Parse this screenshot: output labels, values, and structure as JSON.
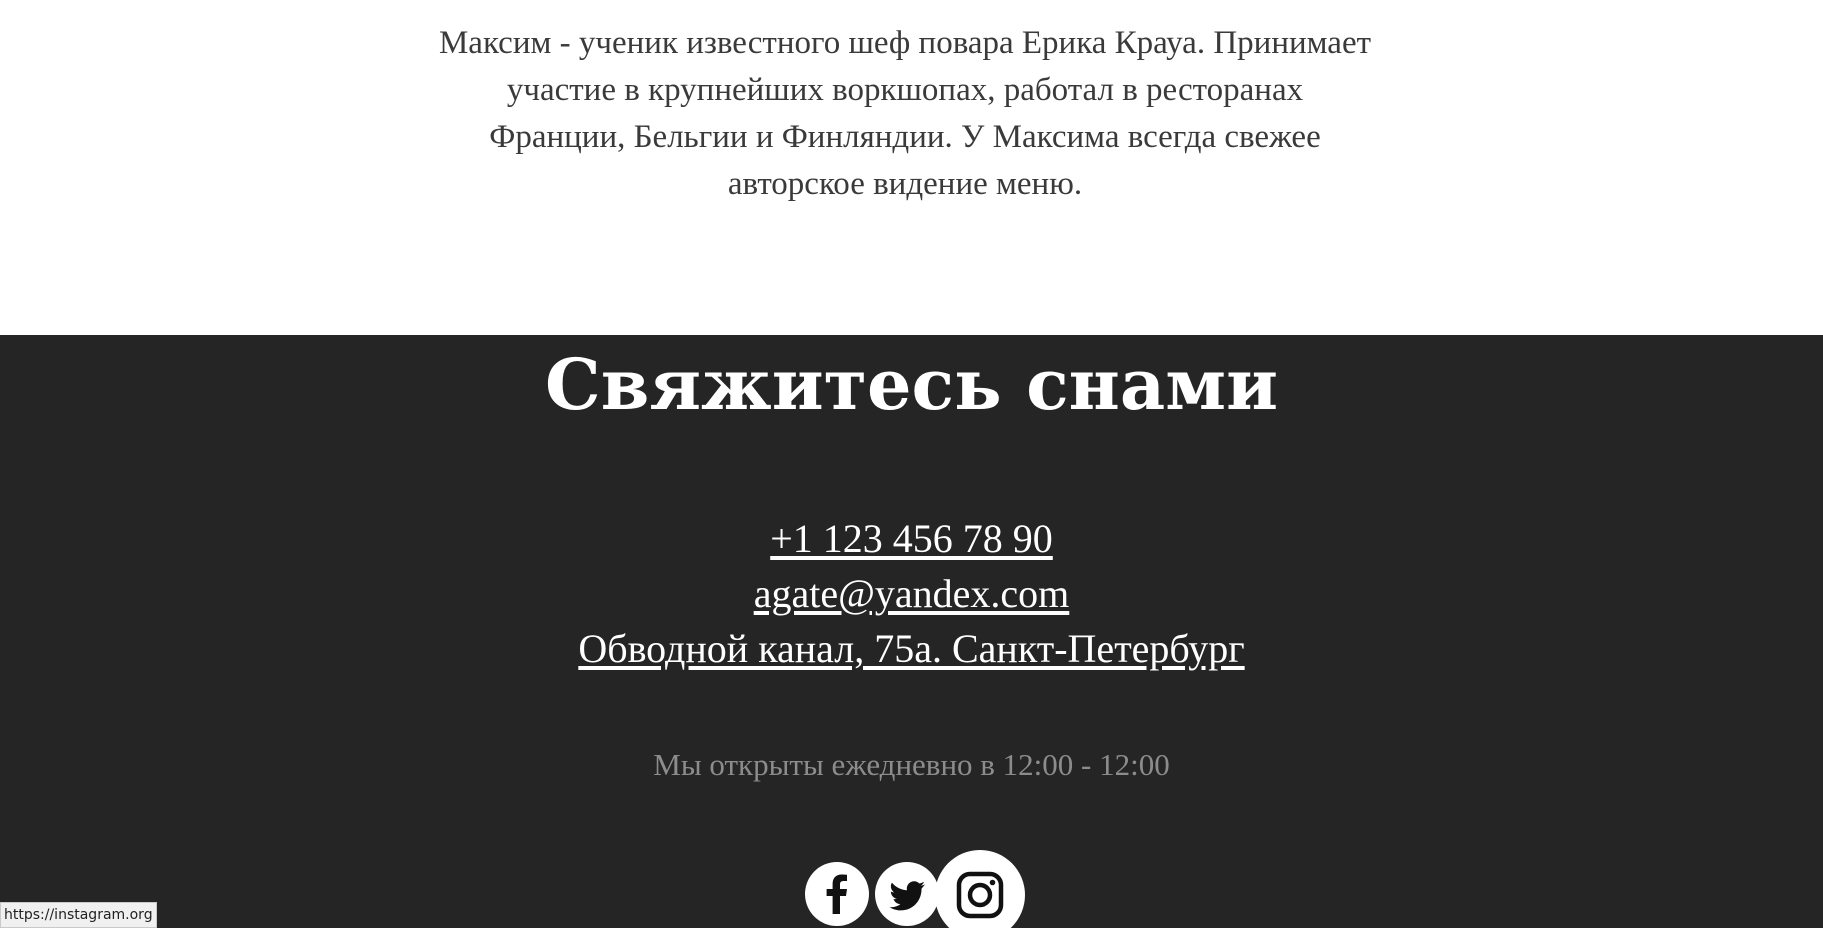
{
  "about": {
    "lines": [
      "Максим - ученик известного шеф повара Ерика Крауа. Принимает",
      "участие в крупнейших воркшопах, работал в ресторанах",
      "Франции, Бельгии и Финляндии. У Максима всегда свежее",
      "авторское видение меню."
    ]
  },
  "contact": {
    "title": "Свяжитесь снами",
    "phone": "+1 123 456 78 90",
    "email": "agate@yandex.com",
    "address": "Обводной канал, 75а. Санкт-Петербург",
    "hours": "Мы открыты ежедневно в 12:00 - 12:00",
    "background_color": "#252525"
  },
  "social": {
    "items": [
      {
        "icon": "facebook-icon"
      },
      {
        "icon": "twitter-icon"
      },
      {
        "icon": "instagram-icon"
      }
    ]
  },
  "status_bar": {
    "url": "https://instagram.org"
  }
}
